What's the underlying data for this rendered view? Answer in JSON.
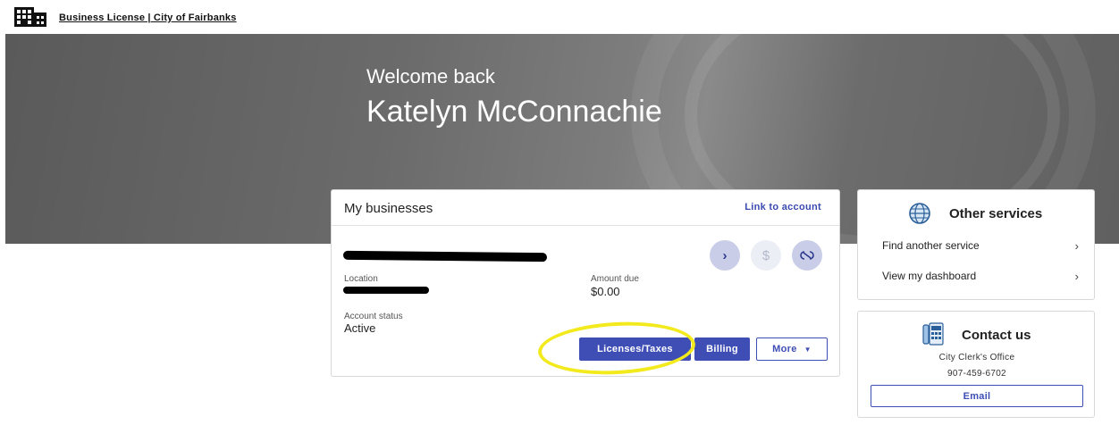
{
  "header": {
    "app_link": "Business License | City of Fairbanks"
  },
  "hero": {
    "welcome": "Welcome back",
    "user_name": "Katelyn McConnachie"
  },
  "businesses": {
    "title": "My businesses",
    "link_label": "Link to account",
    "entry": {
      "location_label": "Location",
      "amount_due_label": "Amount due",
      "amount_due_value": "$0.00",
      "status_label": "Account status",
      "status_value": "Active",
      "buttons": {
        "licenses": "Licenses/Taxes",
        "billing": "Billing",
        "more": "More"
      }
    }
  },
  "other_services": {
    "title": "Other services",
    "items": [
      {
        "label": "Find another service"
      },
      {
        "label": "View my dashboard"
      }
    ]
  },
  "contact": {
    "title": "Contact us",
    "office": "City Clerk's Office",
    "phone": "907-459-6702",
    "email_label": "Email"
  },
  "colors": {
    "primary": "#3f4eb5",
    "highlight": "#f2ea1c"
  }
}
